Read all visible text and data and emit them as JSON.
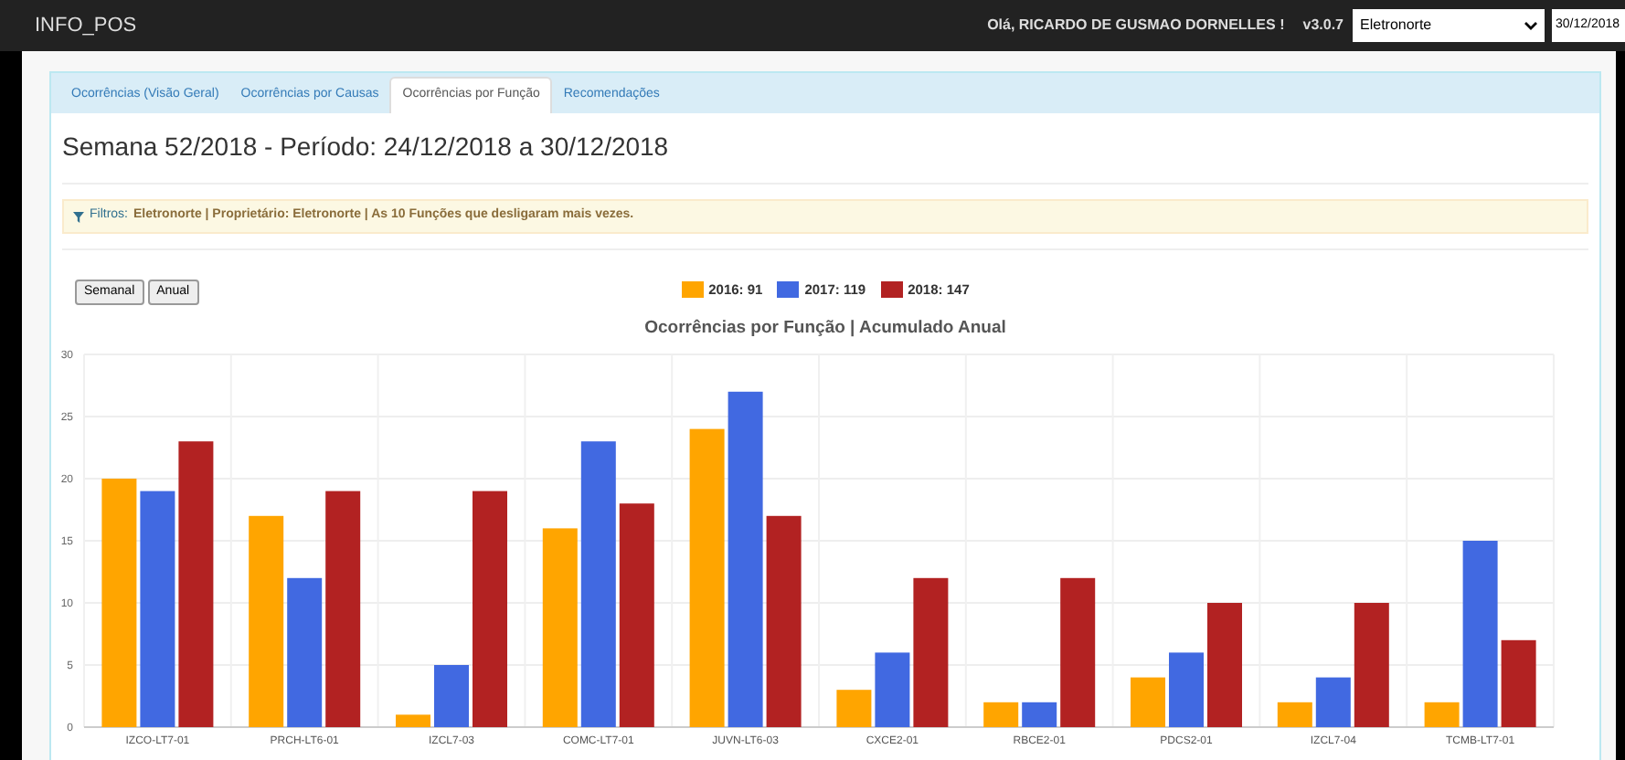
{
  "navbar": {
    "title": "INFO_POS",
    "greeting": "Olá, RICARDO DE GUSMAO DORNELLES !",
    "version": "v3.0.7",
    "company_select": "Eletronorte",
    "date": "30/12/2018"
  },
  "tabs": [
    {
      "label": "Ocorrências (Visão Geral)",
      "selected": false
    },
    {
      "label": "Ocorrências por Causas",
      "selected": false
    },
    {
      "label": "Ocorrências por Função",
      "selected": true
    },
    {
      "label": "Recomendações",
      "selected": false
    }
  ],
  "heading": "Semana 52/2018 - Período: 24/12/2018 a 30/12/2018",
  "filter_alert": {
    "label": "Filtros:",
    "text": "Eletronorte | Proprietário: Eletronorte | As 10 Funções que desligaram mais vezes."
  },
  "buttons": [
    "Semanal",
    "Anual"
  ],
  "chart_data": {
    "type": "bar",
    "title": "Ocorrências por Função | Acumulado Anual",
    "categories": [
      "IZCO-LT7-01",
      "PRCH-LT6-01",
      "IZCL7-03",
      "COMC-LT7-01",
      "JUVN-LT6-03",
      "CXCE2-01",
      "RBCE2-01",
      "PDCS2-01",
      "IZCL7-04",
      "TCMB-LT7-01"
    ],
    "series": [
      {
        "name": "2016: 91",
        "color": "#ffa500",
        "values": [
          20,
          17,
          1,
          16,
          24,
          3,
          2,
          4,
          2,
          2
        ]
      },
      {
        "name": "2017: 119",
        "color": "#4169e1",
        "values": [
          19,
          12,
          5,
          23,
          27,
          6,
          2,
          6,
          4,
          15
        ]
      },
      {
        "name": "2018: 147",
        "color": "#b22222",
        "values": [
          23,
          19,
          19,
          18,
          17,
          12,
          12,
          10,
          10,
          7
        ]
      }
    ],
    "grid": true,
    "ylim": [
      0,
      30
    ],
    "yticks": [
      0,
      5,
      10,
      15,
      20,
      25,
      30
    ]
  }
}
